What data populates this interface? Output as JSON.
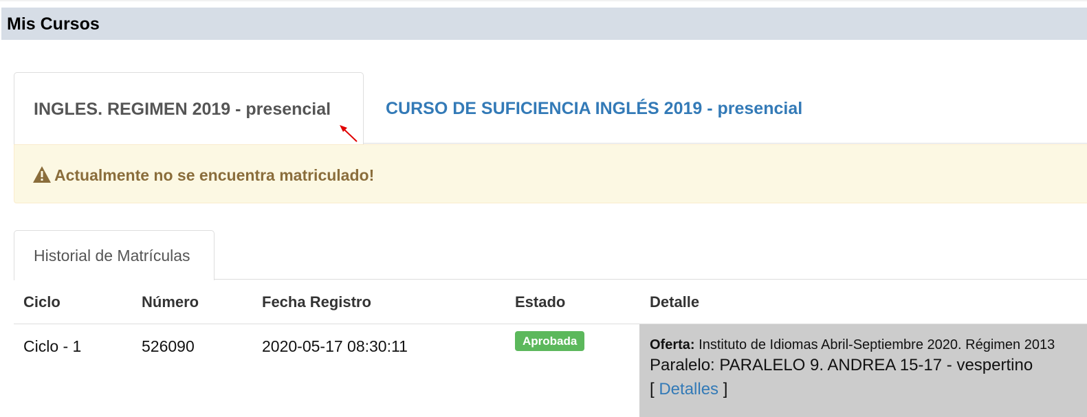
{
  "header": {
    "title": "Mis Cursos"
  },
  "course_tabs": [
    {
      "label": "INGLES. REGIMEN 2019 - presencial",
      "active": true
    },
    {
      "label": "CURSO DE SUFICIENCIA INGLÉS 2019 - presencial",
      "active": false
    }
  ],
  "alert": {
    "icon": "warning-icon",
    "message": "Actualmente no se encuentra matriculado!"
  },
  "history": {
    "tab_label": "Historial de Matrículas"
  },
  "table": {
    "headers": [
      "Ciclo",
      "Número",
      "Fecha Registro",
      "Estado",
      "Detalle"
    ],
    "rows": [
      {
        "ciclo": "Ciclo - 1",
        "numero": "526090",
        "fecha_registro": "2020-05-17 08:30:11",
        "estado": "Aprobada",
        "detalle": {
          "oferta_label": "Oferta:",
          "oferta_value": "Instituto de Idiomas Abril-Septiembre 2020. Régimen 2013",
          "paralelo": "Paralelo: PARALELO 9. ANDREA 15-17 - vespertino",
          "detalles_open": "[",
          "detalles_link": "Detalles",
          "detalles_close": "]"
        }
      }
    ]
  },
  "colors": {
    "header_bg": "#d6dde6",
    "link": "#337ab7",
    "alert_bg": "#fcf8e3",
    "alert_text": "#8a6d3b",
    "badge_success": "#5cb85c",
    "detail_bg": "#cccccc",
    "annotation_arrow": "#e00000"
  }
}
